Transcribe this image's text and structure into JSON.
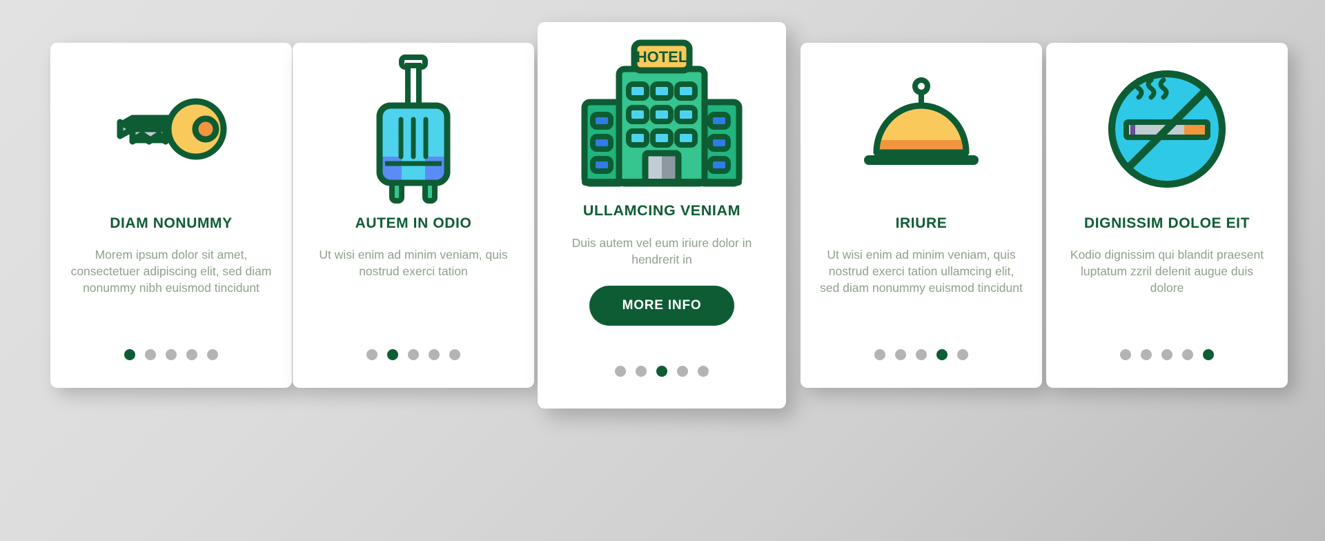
{
  "theme": {
    "background_top": "#e2e2e2",
    "background_bottom": "#bdbdbd",
    "card_bg": "#ffffff",
    "heading_color": "#0e5c33",
    "body_text_color": "#8fa08d",
    "accent_green": "#0e5c33",
    "icon_green_dark": "#0e5c33",
    "icon_green_mid": "#21b47e",
    "icon_green_light": "#36c48f",
    "icon_cyan": "#4ed3ef",
    "icon_blue": "#2f7ce8",
    "icon_yellow": "#f9c95c",
    "icon_orange": "#f2953f",
    "icon_gray": "#c2ccd4",
    "dot_inactive": "#b4b4b4",
    "dot_active": "#0e5c33"
  },
  "cards": [
    {
      "id": "card-key",
      "icon": "key-icon",
      "title": "DIAM NONUMMY",
      "description": "Morem ipsum dolor sit amet, consectetuer adipiscing elit, sed diam nonummy nibh euismod tincidunt",
      "has_button": false,
      "button_label": "",
      "dots_total": 5,
      "dot_active_index": 0
    },
    {
      "id": "card-suitcase",
      "icon": "suitcase-icon",
      "title": "AUTEM IN ODIO",
      "description": "Ut wisi enim ad minim veniam, quis nostrud exerci tation",
      "has_button": false,
      "button_label": "",
      "dots_total": 5,
      "dot_active_index": 1
    },
    {
      "id": "card-hotel",
      "icon": "hotel-building-icon",
      "icon_sign_text": "HOTEL",
      "title": "ULLAMCING VENIAM",
      "description": "Duis autem vel eum iriure dolor in hendrerit in",
      "has_button": true,
      "button_label": "MORE INFO",
      "dots_total": 5,
      "dot_active_index": 2
    },
    {
      "id": "card-bell",
      "icon": "service-bell-icon",
      "title": "IRIURE",
      "description": "Ut wisi enim ad minim veniam, quis nostrud exerci tation ullamcing elit, sed diam nonummy euismod tincidunt",
      "has_button": false,
      "button_label": "",
      "dots_total": 5,
      "dot_active_index": 3
    },
    {
      "id": "card-no-smoking",
      "icon": "no-smoking-icon",
      "title": "DIGNISSIM DOLOE EIT",
      "description": "Kodio dignissim qui blandit praesent luptatum zzril delenit augue duis dolore",
      "has_button": false,
      "button_label": "",
      "dots_total": 5,
      "dot_active_index": 4
    }
  ]
}
